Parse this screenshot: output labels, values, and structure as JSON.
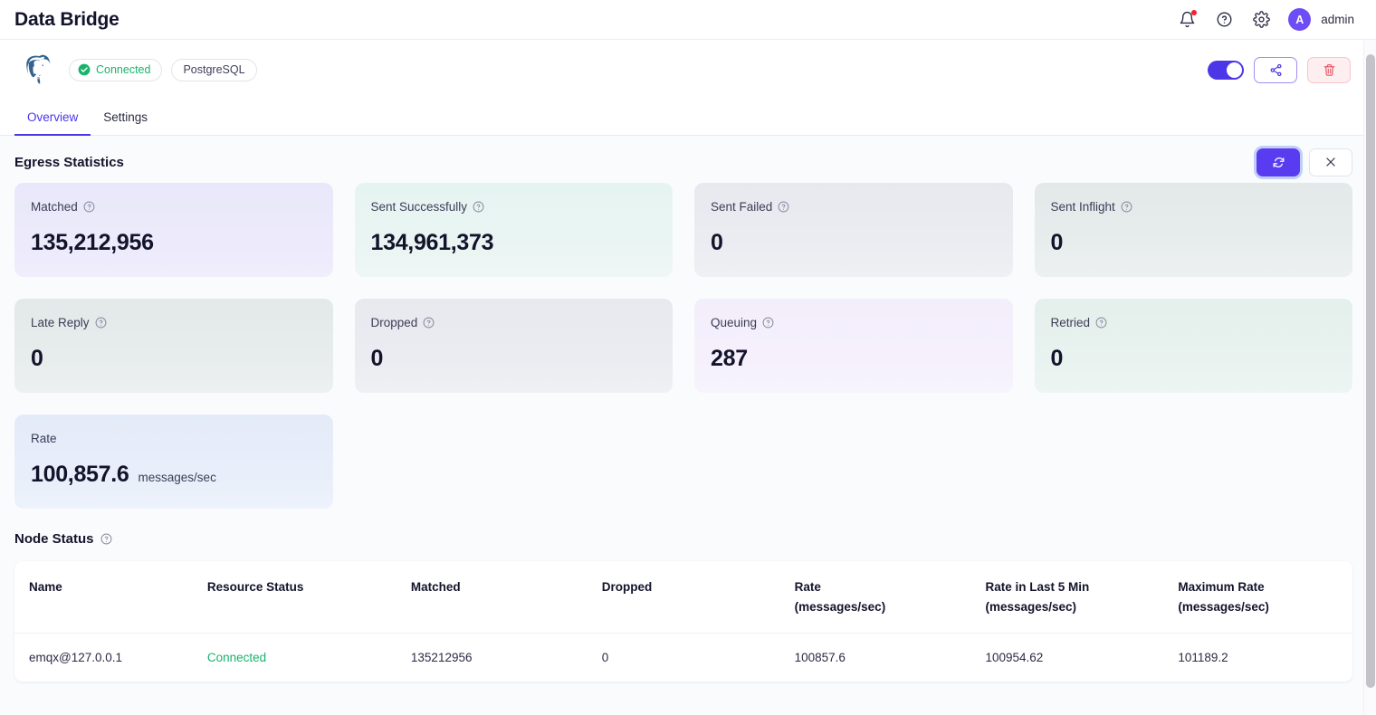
{
  "header": {
    "app_title": "Data Bridge",
    "notification_icon": "bell-icon",
    "help_icon": "question-circle-icon",
    "settings_icon": "gear-icon",
    "avatar_initial": "A",
    "username": "admin"
  },
  "bridge": {
    "logo_icon": "postgresql-elephant-icon",
    "status_label": "Connected",
    "type_label": "PostgreSQL",
    "toggle_enabled": true,
    "share_icon": "share-icon",
    "delete_icon": "trash-icon",
    "accent_color": "#4b37e8",
    "status_color": "#19b36b",
    "danger_color": "#e8505f"
  },
  "tabs": [
    {
      "label": "Overview",
      "active": true
    },
    {
      "label": "Settings",
      "active": false
    }
  ],
  "egress": {
    "title": "Egress Statistics",
    "refresh_icon": "refresh-icon",
    "close_icon": "close-icon",
    "cards": [
      {
        "label": "Matched",
        "value": "135,212,956",
        "unit": "",
        "has_help": true,
        "theme": "c-purple"
      },
      {
        "label": "Sent Successfully",
        "value": "134,961,373",
        "unit": "",
        "has_help": true,
        "theme": "c-mint"
      },
      {
        "label": "Sent Failed",
        "value": "0",
        "unit": "",
        "has_help": true,
        "theme": "c-gray"
      },
      {
        "label": "Sent Inflight",
        "value": "0",
        "unit": "",
        "has_help": true,
        "theme": "c-sage"
      },
      {
        "label": "Late Reply",
        "value": "0",
        "unit": "",
        "has_help": true,
        "theme": "c-sage"
      },
      {
        "label": "Dropped",
        "value": "0",
        "unit": "",
        "has_help": true,
        "theme": "c-gray"
      },
      {
        "label": "Queuing",
        "value": "287",
        "unit": "",
        "has_help": true,
        "theme": "c-lav"
      },
      {
        "label": "Retried",
        "value": "0",
        "unit": "",
        "has_help": true,
        "theme": "c-green"
      },
      {
        "label": "Rate",
        "value": "100,857.6",
        "unit": "messages/sec",
        "has_help": false,
        "theme": "c-blue"
      }
    ]
  },
  "node_status": {
    "title": "Node Status",
    "has_help": true,
    "columns": [
      {
        "line1": "Name",
        "line2": ""
      },
      {
        "line1": "Resource Status",
        "line2": ""
      },
      {
        "line1": "Matched",
        "line2": ""
      },
      {
        "line1": "Dropped",
        "line2": ""
      },
      {
        "line1": "Rate",
        "line2": "(messages/sec)"
      },
      {
        "line1": "Rate in Last 5 Min",
        "line2": "(messages/sec)"
      },
      {
        "line1": "Maximum Rate",
        "line2": "(messages/sec)"
      }
    ],
    "rows": [
      {
        "name": "emqx@127.0.0.1",
        "resource_status": "Connected",
        "matched": "135212956",
        "dropped": "0",
        "rate": "100857.6",
        "rate_5min": "100954.62",
        "max_rate": "101189.2"
      }
    ]
  }
}
